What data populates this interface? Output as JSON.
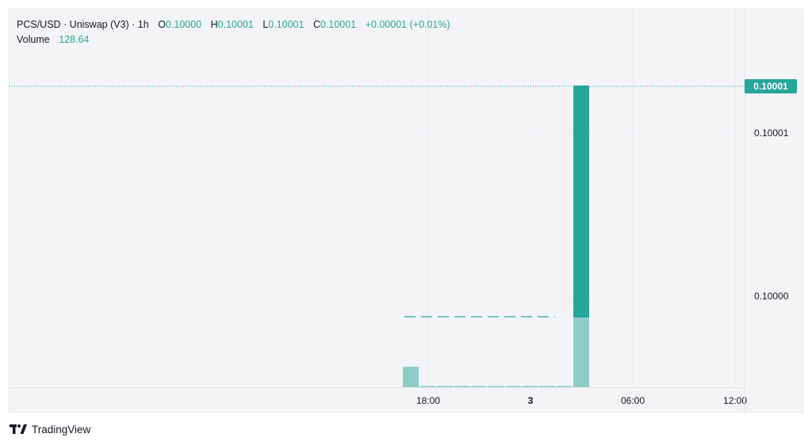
{
  "legend": {
    "symbol": "PCS/USD · Uniswap (V3) · 1h",
    "open_label": "O",
    "open": "0.10000",
    "high_label": "H",
    "high": "0.10001",
    "low_label": "L",
    "low": "0.10001",
    "close_label": "C",
    "close": "0.10001",
    "change": "+0.00001 (+0.01%)",
    "volume_label": "Volume",
    "volume": "128.64"
  },
  "last_price_tag": "0.10001",
  "brand": {
    "name": "TradingView",
    "icon": "tradingview-logo-icon"
  },
  "colors": {
    "up": "#26a69a",
    "volume": "#8ecdc7",
    "grid": "#e8eaed",
    "axis_text": "#131722"
  },
  "chart_data": {
    "type": "candlestick",
    "interval": "1h",
    "price_axis": {
      "ticks": [
        {
          "value": 0.1,
          "label": "0.10000"
        },
        {
          "value": 0.10001,
          "label": "0.10001"
        }
      ]
    },
    "time_axis": {
      "ticks": [
        {
          "label": "18:00",
          "bold": false
        },
        {
          "label": "3",
          "bold": true
        },
        {
          "label": "06:00",
          "bold": false
        },
        {
          "label": "12:00",
          "bold": false
        }
      ]
    },
    "candles": [
      {
        "o": 0.1,
        "h": 0.10001,
        "l": 0.1,
        "c": 0.10001
      }
    ],
    "volume_bars": [
      {
        "value": 28
      },
      {
        "value": 0.5
      },
      {
        "value": 0.5
      },
      {
        "value": 0.5
      },
      {
        "value": 0.5
      },
      {
        "value": 0.5
      },
      {
        "value": 0.5
      },
      {
        "value": 0.5
      },
      {
        "value": 0.5
      },
      {
        "value": 0.5
      },
      {
        "value": 128.64
      }
    ],
    "last_price": 0.10001,
    "grid": true
  }
}
